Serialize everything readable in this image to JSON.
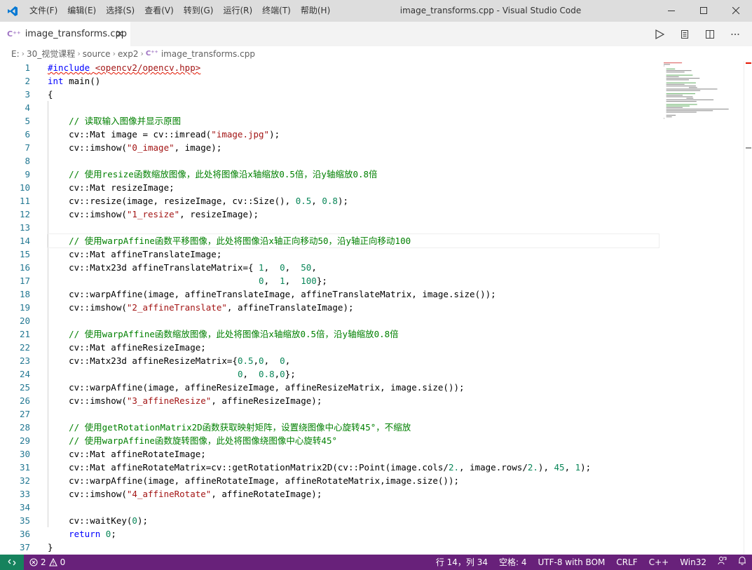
{
  "titlebar": {
    "menu": [
      "文件(F)",
      "编辑(E)",
      "选择(S)",
      "查看(V)",
      "转到(G)",
      "运行(R)",
      "终端(T)",
      "帮助(H)"
    ],
    "title": "image_transforms.cpp - Visual Studio Code"
  },
  "tab": {
    "label": "image_transforms.cpp",
    "icon": "C⁺⁺"
  },
  "breadcrumb": [
    "E:",
    "30_视觉课程",
    "source",
    "exp2",
    "image_transforms.cpp"
  ],
  "code": {
    "current_line": 14,
    "lines": [
      "#include <opencv2/opencv.hpp>",
      "int main()",
      "{",
      "",
      "    // 读取输入图像并显示原图",
      "    cv::Mat image = cv::imread(\"image.jpg\");",
      "    cv::imshow(\"0_image\", image);",
      "",
      "    // 使用resize函数缩放图像，此处将图像沿x轴缩放0.5倍，沿y轴缩放0.8倍",
      "    cv::Mat resizeImage;",
      "    cv::resize(image, resizeImage, cv::Size(), 0.5, 0.8);",
      "    cv::imshow(\"1_resize\", resizeImage);",
      "",
      "    // 使用warpAffine函数平移图像，此处将图像沿x轴正向移动50，沿y轴正向移动100",
      "    cv::Mat affineTranslateImage;",
      "    cv::Matx23d affineTranslateMatrix={ 1,  0,  50,",
      "                                        0,  1,  100};",
      "    cv::warpAffine(image, affineTranslateImage, affineTranslateMatrix, image.size());",
      "    cv::imshow(\"2_affineTranslate\", affineTranslateImage);",
      "",
      "    // 使用warpAffine函数缩放图像，此处将图像沿x轴缩放0.5倍，沿y轴缩放0.8倍",
      "    cv::Mat affineResizeImage;",
      "    cv::Matx23d affineResizeMatrix={0.5,0,  0,",
      "                                    0,  0.8,0};",
      "    cv::warpAffine(image, affineResizeImage, affineResizeMatrix, image.size());",
      "    cv::imshow(\"3_affineResize\", affineResizeImage);",
      "",
      "    // 使用getRotationMatrix2D函数获取映射矩阵，设置绕图像中心旋转45°，不缩放",
      "    // 使用warpAffine函数旋转图像，此处将图像绕图像中心旋转45°",
      "    cv::Mat affineRotateImage;",
      "    cv::Mat affineRotateMatrix=cv::getRotationMatrix2D(cv::Point(image.cols/2., image.rows/2.), 45, 1);",
      "    cv::warpAffine(image, affineRotateImage, affineRotateMatrix,image.size());",
      "    cv::imshow(\"4_affineRotate\", affineRotateImage);",
      "",
      "    cv::waitKey(0);",
      "    return 0;",
      "}"
    ]
  },
  "statusbar": {
    "errors": "2",
    "warnings": "0",
    "position": "行 14，列 34",
    "spaces": "空格: 4",
    "encoding": "UTF-8 with BOM",
    "eol": "CRLF",
    "language": "C++",
    "platform": "Win32"
  },
  "colors": {
    "statusbar": "#68217a",
    "remote": "#16825d",
    "comment": "#008000",
    "keyword": "#0000ff",
    "string": "#a31515",
    "number": "#098658",
    "line_number": "#237893"
  }
}
